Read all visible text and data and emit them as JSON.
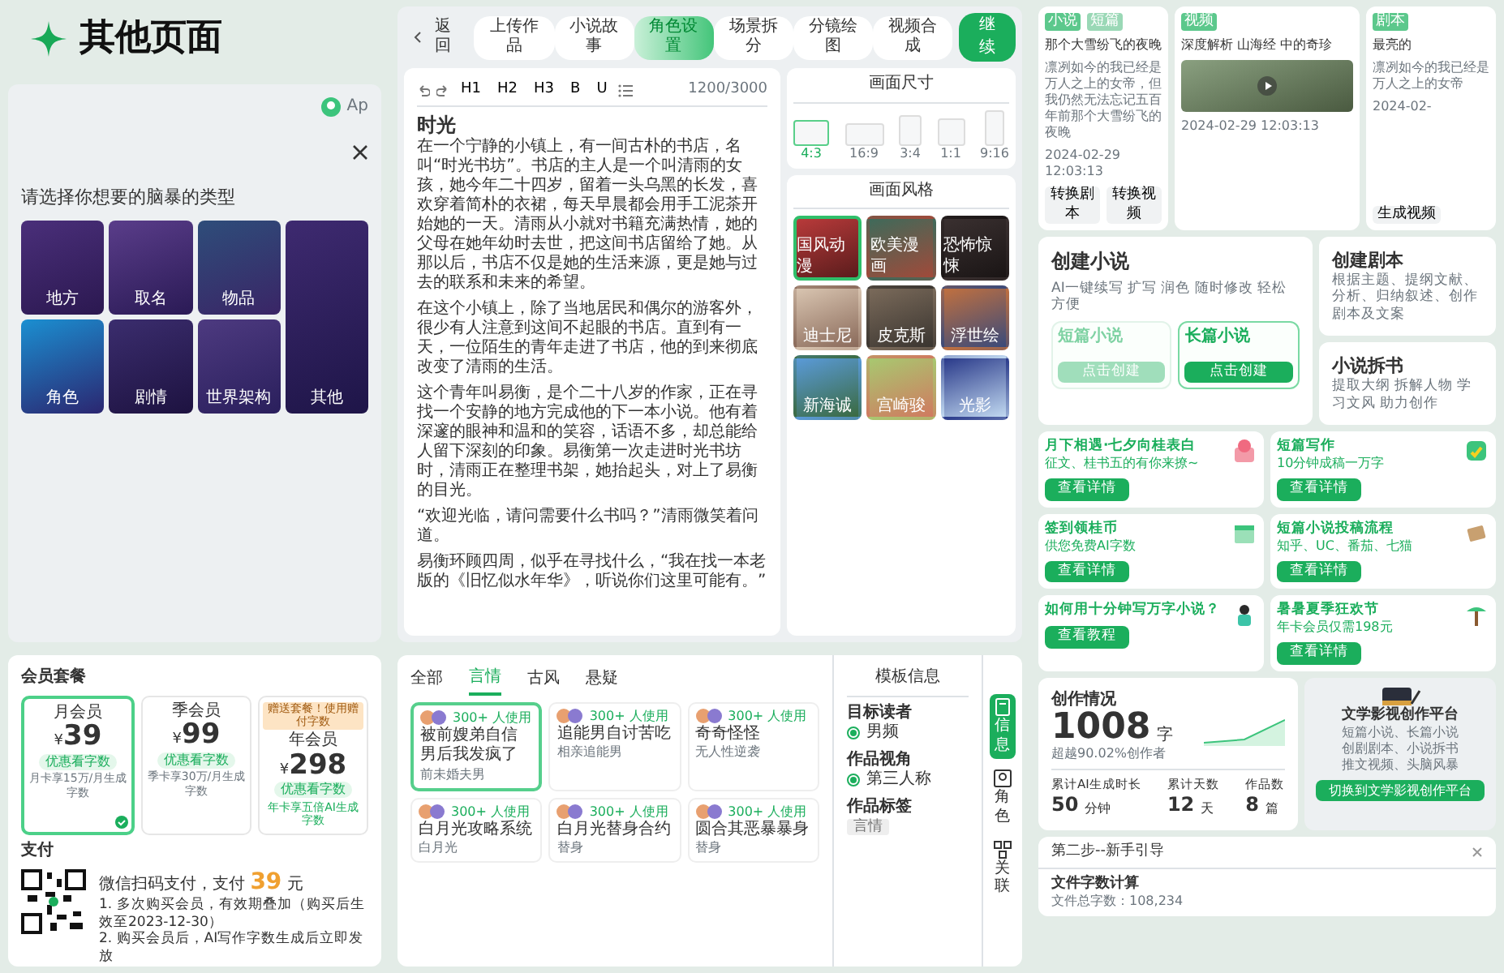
{
  "header": {
    "title": "其他页面"
  },
  "brainstorm": {
    "avatar_label": "Ap",
    "prompt": "请选择你想要的脑暴的类型",
    "types": [
      {
        "label": "地方",
        "kind": "small"
      },
      {
        "label": "取名",
        "kind": "small"
      },
      {
        "label": "物品",
        "kind": "small"
      },
      {
        "label": "角色",
        "kind": "small"
      },
      {
        "label": "剧情",
        "kind": "small"
      },
      {
        "label": "世界架构",
        "kind": "small"
      },
      {
        "label": "其他",
        "kind": "tall"
      }
    ]
  },
  "editor": {
    "back": "返回",
    "steps": [
      {
        "label": "上传作品",
        "selected": false
      },
      {
        "label": "小说故事",
        "selected": false
      },
      {
        "label": "角色设置",
        "selected": true
      },
      {
        "label": "场景拆分",
        "selected": false
      },
      {
        "label": "分镜绘图",
        "selected": false
      },
      {
        "label": "视频合成",
        "selected": false
      }
    ],
    "next_button": "继续",
    "toolbar_labels": [
      "H1",
      "H2",
      "H3",
      "B",
      "U"
    ],
    "counter": "1200/3000",
    "title": "时光",
    "paragraphs": [
      "在一个宁静的小镇上，有一间古朴的书店，名叫“时光书坊”。书店的主人是一个叫清雨的女孩，她今年二十四岁，留着一头乌黑的长发，喜欢穿着简朴的衣裙，每天早晨都会用手工泥茶开始她的一天。清雨从小就对书籍充满热情，她的父母在她年幼时去世，把这间书店留给了她。从那以后，书店不仅是她的生活来源，更是她与过去的联系和未来的希望。",
      "在这个小镇上，除了当地居民和偶尔的游客外，很少有人注意到这间不起眼的书店。直到有一天，一位陌生的青年走进了书店，他的到来彻底改变了清雨的生活。",
      "这个青年叫易衡，是个二十八岁的作家，正在寻找一个安静的地方完成他的下一本小说。他有着深邃的眼神和温和的笑容，话语不多，却总能给人留下深刻的印象。易衡第一次走进时光书坊时，清雨正在整理书架，她抬起头，对上了易衡的目光。",
      "“欢迎光临，请问需要什么书吗？”清雨微笑着问道。",
      "易衡环顾四周，似乎在寻找什么，“我在找一本老版的《旧忆似水年华》，听说你们这里可能有。”"
    ]
  },
  "canvas": {
    "size_title": "画面尺寸",
    "sizes": [
      {
        "label": "4:3",
        "selected": true
      },
      {
        "label": "16:9",
        "selected": false
      },
      {
        "label": "3:4",
        "selected": false
      },
      {
        "label": "1:1",
        "selected": false
      },
      {
        "label": "9:16",
        "selected": false
      }
    ],
    "style_title": "画面风格",
    "styles": [
      {
        "label": "国风动漫",
        "selected": true
      },
      {
        "label": "欧美漫画",
        "selected": false
      },
      {
        "label": "恐怖惊悚",
        "selected": false
      },
      {
        "label": "迪士尼",
        "selected": false
      },
      {
        "label": "皮克斯",
        "selected": false
      },
      {
        "label": "浮世绘",
        "selected": false
      },
      {
        "label": "新海诚",
        "selected": false
      },
      {
        "label": "宫崎骏",
        "selected": false
      },
      {
        "label": "光影",
        "selected": false
      }
    ]
  },
  "membership": {
    "title": "会员套餐",
    "plans": [
      {
        "name": "月会员",
        "currency": "¥",
        "price": "39",
        "perk": "优惠看字数",
        "note": "月卡享15万/月生成字数",
        "selected": true
      },
      {
        "name": "季会员",
        "currency": "¥",
        "price": "99",
        "perk": "优惠看字数",
        "note": "季卡享30万/月生成字数",
        "selected": false
      },
      {
        "name": "年会员",
        "currency": "¥",
        "price": "298",
        "perk": "优惠看字数",
        "note": "年卡享五倍AI生成字数",
        "badge": "赠送套餐！使用赠付字数",
        "selected": false
      }
    ],
    "pay_title": "支付",
    "pay_line": "微信扫码支付，支付",
    "pay_amount": "39",
    "pay_unit": "元",
    "notes": [
      "1. 多次购买会员，有效期叠加（购买后生效至2023-12-30）",
      "2. 购买会员后，AI写作字数生成后立即发放"
    ]
  },
  "templates": {
    "tabs": [
      {
        "label": "全部",
        "selected": false
      },
      {
        "label": "言情",
        "selected": true
      },
      {
        "label": "古风",
        "selected": false
      },
      {
        "label": "悬疑",
        "selected": false
      }
    ],
    "cards": [
      {
        "usage": "300+ 人使用",
        "title": "被前嫂弟自信男后我发疯了",
        "tag": "前未婚夫男",
        "selected": true
      },
      {
        "usage": "300+ 人使用",
        "title": "追能男自讨苦吃",
        "tag": "相亲追能男",
        "selected": false
      },
      {
        "usage": "300+ 人使用",
        "title": "奇奇怪怪",
        "tag": "无人性逆袭",
        "selected": false
      },
      {
        "usage": "300+ 人使用",
        "title": "白月光攻略系统",
        "tag": "白月光",
        "selected": false
      },
      {
        "usage": "300+ 人使用",
        "title": "白月光替身合约",
        "tag": "替身",
        "selected": false
      },
      {
        "usage": "300+ 人使用",
        "title": "圆合其恶暴暴身",
        "tag": "替身",
        "selected": false
      }
    ],
    "info_title": "模板信息",
    "fields": [
      {
        "label": "目标读者",
        "value": "男频",
        "kind": "radio"
      },
      {
        "label": "作品视角",
        "value": "第三人称",
        "kind": "radio"
      },
      {
        "label": "作品标签",
        "value": "言情",
        "kind": "tag"
      }
    ],
    "side_tabs": [
      {
        "label": "信息",
        "selected": true
      },
      {
        "label": "角色",
        "selected": false
      },
      {
        "label": "关联",
        "selected": false
      }
    ]
  },
  "articles": [
    {
      "tags": [
        "小说",
        "短篇"
      ],
      "title": "那个大雪纷飞的夜晚",
      "body": "凛冽如今的我已经是万人之上的女帝，但我仍然无法忘记五百年前那个大雪纷飞的夜晚",
      "date": "2024-02-29 12:03:13",
      "actions": [
        "转换剧本",
        "转换视频"
      ],
      "kind": "text"
    },
    {
      "tags": [
        "视频"
      ],
      "title": "深度解析 山海经 中的奇珍",
      "date": "2024-02-29 12:03:13",
      "kind": "video"
    },
    {
      "tags": [
        "剧本"
      ],
      "title": "最亮的",
      "body": "凛冽如今的我已经是万人之上的女帝",
      "date": "2024-02-",
      "actions": [
        "生成视频"
      ],
      "kind": "text"
    }
  ],
  "create": {
    "novel": {
      "title": "创建小说",
      "desc": "AI一键续写 扩写 润色 随时修改 轻松方便",
      "options": [
        {
          "label": "短篇小说",
          "button": "点击创建",
          "selected": false
        },
        {
          "label": "长篇小说",
          "button": "点击创建",
          "selected": true
        }
      ]
    },
    "script": {
      "title": "创建剧本",
      "desc": "根据主题、提纲文献、分析、归纳叙述、创作剧本及文案"
    },
    "split": {
      "title": "小说拆书",
      "desc": "提取大纲 拆解人物 学习文风 助力创作"
    }
  },
  "promos": [
    {
      "title": "月下相遇·七夕向桂表白",
      "sub": "征文、桂书五的有你来撩~",
      "button": "查看详情"
    },
    {
      "title": "短篇写作",
      "sub": "10分钟成稿一万字",
      "button": "查看详情"
    },
    {
      "title": "签到领桂币",
      "sub": "供您免费AI字数",
      "button": "查看详情"
    },
    {
      "title": "短篇小说投稿流程",
      "sub": "知乎、UC、番茄、七猫",
      "button": "查看详情"
    },
    {
      "title": "如何用十分钟写万字小说？",
      "button": "查看教程"
    },
    {
      "title": "暑暑夏季狂欢节",
      "sub": "年卡会员仅需198元",
      "button": "查看详情"
    }
  ],
  "stats": {
    "title": "创作情况",
    "total": "1008",
    "unit": "字",
    "rank": "超越90.02%创作者",
    "items": [
      {
        "label": "累计AI生成时长",
        "value": "50",
        "unit": "分钟"
      },
      {
        "label": "累计天数",
        "value": "12",
        "unit": "天"
      },
      {
        "label": "作品数",
        "value": "8",
        "unit": "篇"
      }
    ]
  },
  "platform": {
    "title": "文学影视创作平台",
    "lines": [
      "短篇小说、长篇小说",
      "创剧剧本、小说拆书",
      "推文视频、头脑风暴"
    ],
    "button": "切换到文学影视创作平台"
  },
  "guide": {
    "title": "第二步--新手引导",
    "heading": "文件字数计算",
    "line": "文件总字数：108,234"
  }
}
